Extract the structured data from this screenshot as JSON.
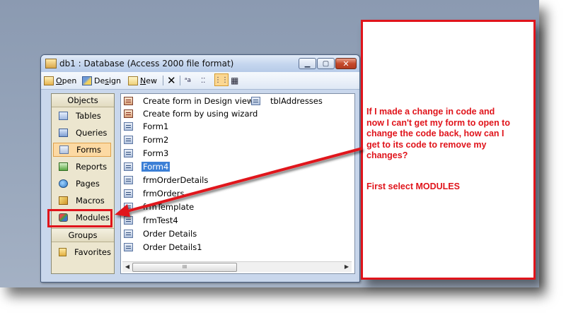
{
  "window": {
    "title": "db1 : Database (Access 2000 file format)",
    "min_glyph": "▁",
    "max_glyph": "▢",
    "close_glyph": "✕"
  },
  "toolbar": {
    "open_prefix": "",
    "open_underline": "O",
    "open_rest": "pen",
    "design_prefix": "De",
    "design_underline": "s",
    "design_rest": "ign",
    "new_underline": "N",
    "new_rest": "ew",
    "delete_glyph": "✕",
    "large_icons_glyph": "ᵃa",
    "small_icons_glyph": "⁚⁚",
    "list_glyph": "⋮⋮",
    "details_glyph": "▦"
  },
  "objects_pane": {
    "header": "Objects",
    "items": [
      {
        "label": "Tables"
      },
      {
        "label": "Queries"
      },
      {
        "label": "Forms"
      },
      {
        "label": "Reports"
      },
      {
        "label": "Pages"
      },
      {
        "label": "Macros"
      },
      {
        "label": "Modules"
      }
    ],
    "groups_header": "Groups",
    "groups_items": [
      {
        "label": "Favorites"
      }
    ]
  },
  "list": {
    "column1": [
      "Create form in Design view",
      "Create form by using wizard",
      "Form1",
      "Form2",
      "Form3",
      "Form4",
      "frmOrderDetails",
      "frmOrders",
      "frmTemplate",
      "frmTest4",
      "Order Details",
      "Order Details1"
    ],
    "column2": [
      "tblAddresses"
    ],
    "selected": "Form4"
  },
  "scrollbar": {
    "left": "◀",
    "right": "▶",
    "thumb": "III"
  },
  "callout": {
    "text": "If I made a change in code and\nnow I can't get my form to open to\nchange the code back, how can I\nget to its code to remove my\nchanges?",
    "instruction": "First select MODULES"
  },
  "colors": {
    "annotation_red": "#e0141b",
    "selection_blue": "#3b7fd6",
    "forms_highlight": "#fcd9a3"
  }
}
